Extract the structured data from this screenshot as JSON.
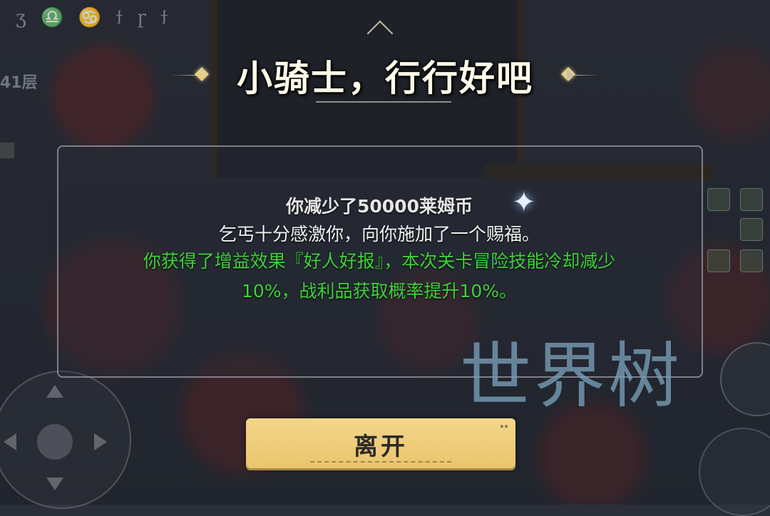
{
  "hud": {
    "top_glyphs": "ʒ ♎ ♋ ϯ ɼ ϯ",
    "floor_label": "41层"
  },
  "event": {
    "title": "小骑士，行行好吧",
    "lines": [
      "你减少了50000莱姆币",
      "乞丐十分感激你，向你施加了一个赐福。",
      "你获得了增益效果『好人好报』，本次关卡冒险技能冷却减少",
      "10%，战利品获取概率提升10%。"
    ],
    "leave_label": "离开"
  },
  "watermark": "世界树",
  "colors": {
    "title": "#fffbe8",
    "buff_text": "#3fd13a",
    "button": "#f3d68a",
    "watermark": "#78a0b9"
  }
}
